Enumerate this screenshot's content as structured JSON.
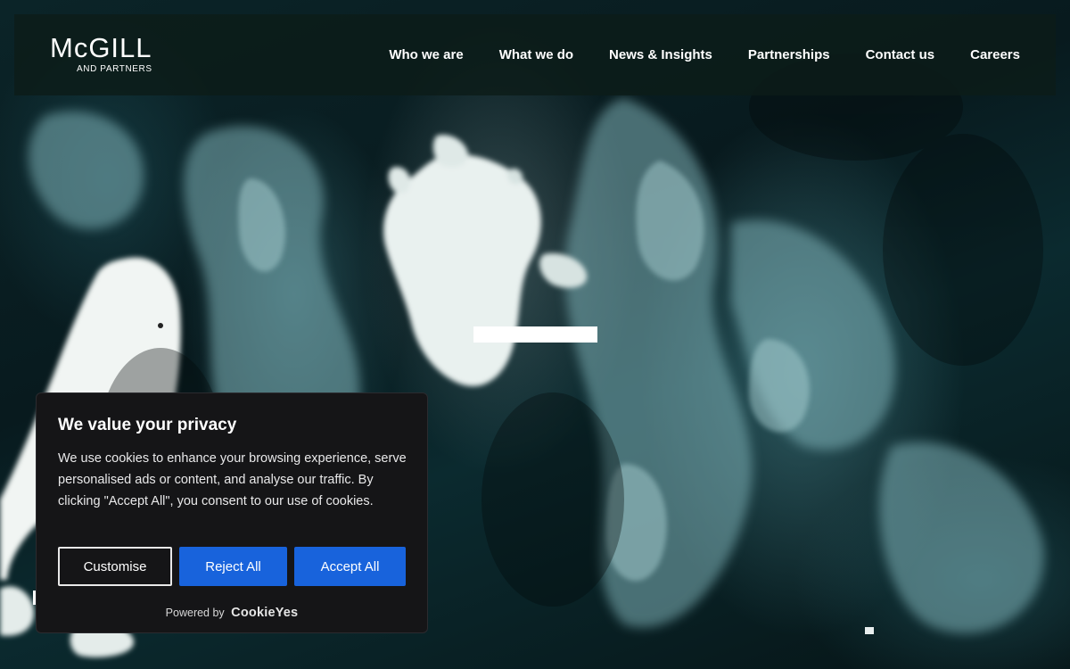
{
  "logo": {
    "main": "McGILL",
    "sub": "AND PARTNERS"
  },
  "nav": {
    "items": [
      {
        "label": "Who we are"
      },
      {
        "label": "What we do"
      },
      {
        "label": "News & Insights"
      },
      {
        "label": "Partnerships"
      },
      {
        "label": "Contact us"
      },
      {
        "label": "Careers"
      }
    ]
  },
  "cookie": {
    "title": "We value your privacy",
    "text": "We use cookies to enhance your browsing experience, serve personalised ads or content, and analyse our traffic. By clicking \"Accept All\", you consent to our use of cookies.",
    "customise_label": "Customise",
    "reject_label": "Reject All",
    "accept_label": "Accept All",
    "powered_by": "Powered by",
    "brand": "CookieYes"
  },
  "colors": {
    "primary_button": "#1863dc",
    "banner_bg": "#151517",
    "navbar_bg": "#0c1c18"
  }
}
